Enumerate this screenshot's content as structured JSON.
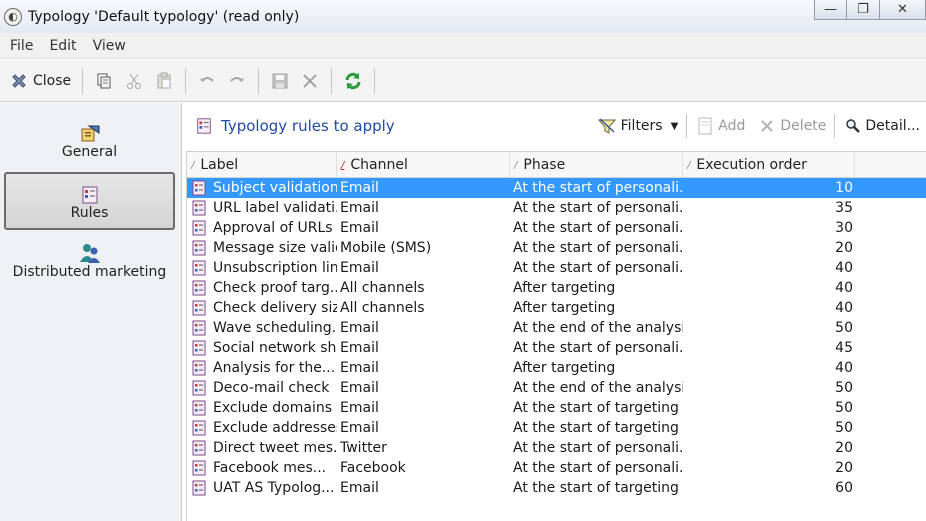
{
  "window": {
    "title": "Typology 'Default typology' (read only)",
    "minimize_glyph": "—",
    "restore_glyph": "❐",
    "close_glyph": "✕"
  },
  "menu": [
    "File",
    "Edit",
    "View"
  ],
  "toolbar": {
    "close_label": "Close",
    "icons": [
      "close-icon",
      "copy-icon",
      "cut-icon",
      "paste-icon",
      "undo-icon",
      "redo-icon",
      "save-icon",
      "delete-icon",
      "refresh-icon"
    ]
  },
  "sidebar": {
    "items": [
      {
        "label": "General",
        "icon": "general-icon",
        "selected": false
      },
      {
        "label": "Rules",
        "icon": "rules-icon",
        "selected": true
      },
      {
        "label": "Distributed marketing",
        "icon": "distributed-marketing-icon",
        "selected": false
      }
    ]
  },
  "main": {
    "section_title": "Typology rules to apply",
    "actions": {
      "filters": "Filters",
      "add": "Add",
      "delete": "Delete",
      "detail": "Detail..."
    }
  },
  "table": {
    "columns": [
      "Label",
      "Channel",
      "Phase",
      "Execution order"
    ],
    "selected_row": 0,
    "rows": [
      {
        "label": "Subject validation",
        "channel": "Email",
        "phase": "At the start of personali...",
        "order": "10"
      },
      {
        "label": "URL label validati...",
        "channel": "Email",
        "phase": "At the start of personali...",
        "order": "35"
      },
      {
        "label": "Approval of URLs",
        "channel": "Email",
        "phase": "At the start of personali...",
        "order": "30"
      },
      {
        "label": "Message size valid...",
        "channel": "Mobile (SMS)",
        "phase": "At the start of personali...",
        "order": "20"
      },
      {
        "label": "Unsubscription lin...",
        "channel": "Email",
        "phase": "At the start of personali...",
        "order": "40"
      },
      {
        "label": "Check proof targ...",
        "channel": "All channels",
        "phase": "After targeting",
        "order": "40"
      },
      {
        "label": "Check delivery size",
        "channel": "All channels",
        "phase": "After targeting",
        "order": "40"
      },
      {
        "label": "Wave scheduling...",
        "channel": "Email",
        "phase": "At the end of the analysis",
        "order": "50"
      },
      {
        "label": "Social network sh...",
        "channel": "Email",
        "phase": "At the start of personali...",
        "order": "45"
      },
      {
        "label": "Analysis for the...",
        "channel": "Email",
        "phase": "After targeting",
        "order": "40"
      },
      {
        "label": "Deco-mail check",
        "channel": "Email",
        "phase": "At the end of the analysis",
        "order": "50"
      },
      {
        "label": "Exclude domains",
        "channel": "Email",
        "phase": "At the start of targeting",
        "order": "50"
      },
      {
        "label": "Exclude addresses",
        "channel": "Email",
        "phase": "At the start of targeting",
        "order": "50"
      },
      {
        "label": "Direct tweet mes...",
        "channel": "Twitter",
        "phase": "At the start of personali...",
        "order": "20"
      },
      {
        "label": "Facebook mes...",
        "channel": "Facebook",
        "phase": "At the start of personali...",
        "order": "20"
      },
      {
        "label": "UAT AS Typolog...",
        "channel": "Email",
        "phase": "At the start of targeting",
        "order": "60"
      }
    ]
  },
  "colors": {
    "selection": "#3399ff",
    "title_link": "#1e4ba8",
    "refresh_green": "#2a9a3a"
  }
}
